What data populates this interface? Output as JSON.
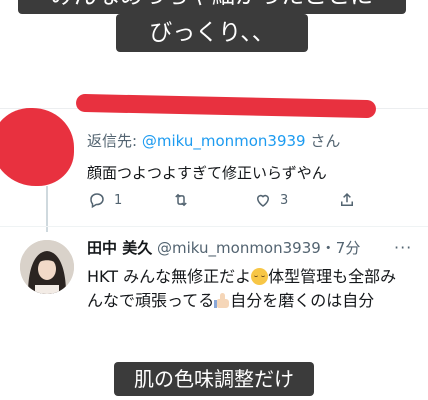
{
  "captions": {
    "top_line1": "みんなめっちゃ細かったことに",
    "top_line2": "びっくり、、",
    "bottom": "肌の色味調整だけ"
  },
  "tweet1": {
    "reply_prefix": "返信先: ",
    "reply_handle": "@miku_monmon3939",
    "reply_suffix": " さん",
    "text": "顔面つよつよすぎて修正いらずやん",
    "actions": {
      "reply_count": "1",
      "retweet_count": "",
      "like_count": "3"
    }
  },
  "tweet2": {
    "name": "田中 美久",
    "handle": "@miku_monmon3939",
    "time": "・7分",
    "line1_a": "HKT みんな無修正だよ",
    "line1_b": "体型管理も全部み",
    "line2_a": "んなで頑張ってる",
    "line2_b": "自分を磨くのは自分"
  },
  "colors": {
    "accent": "#1d9bf0",
    "redaction": "#e8313f",
    "caption_bg": "#3b3b3b",
    "muted": "#536471"
  },
  "icons": [
    "reply-icon",
    "retweet-icon",
    "like-icon",
    "share-icon",
    "more-icon",
    "relieved-face-emoji",
    "thumbs-up-emoji"
  ]
}
